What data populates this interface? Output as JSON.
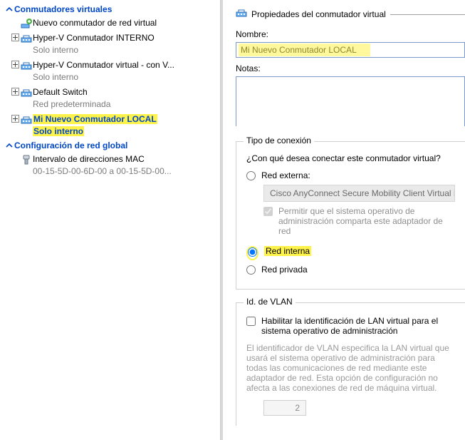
{
  "tree": {
    "section1_label": "Conmutadores virtuales",
    "items": [
      {
        "title": "Nuevo conmutador de red virtual",
        "sub": null,
        "expandable": false,
        "icon": "new-switch"
      },
      {
        "title": "Hyper-V Conmutador INTERNO",
        "sub": "Solo interno",
        "expandable": true,
        "icon": "switch"
      },
      {
        "title": "Hyper-V Conmutador virtual - con V...",
        "sub": "Solo interno",
        "expandable": true,
        "icon": "switch"
      },
      {
        "title": "Default Switch",
        "sub": "Red predeterminada",
        "expandable": true,
        "icon": "switch"
      },
      {
        "title": "Mi Nuevo Conmutador LOCAL",
        "sub": "Solo interno",
        "expandable": true,
        "icon": "switch",
        "selected": true,
        "highlighted": true
      }
    ],
    "section2_label": "Configuración de red global",
    "global_items": [
      {
        "title": "Intervalo de direcciones MAC",
        "sub": "00-15-5D-00-6D-00 a 00-15-5D-00...",
        "icon": "mac"
      }
    ]
  },
  "right": {
    "header_title": "Propiedades del conmutador virtual",
    "name_label": "Nombre:",
    "name_value": "Mi Nuevo Conmutador LOCAL",
    "notes_label": "Notas:",
    "notes_value": "",
    "conn": {
      "group_title": "Tipo de conexión",
      "question": "¿Con qué desea conectar este conmutador virtual?",
      "external_label": "Red externa:",
      "adapter_value": "Cisco AnyConnect Secure Mobility Client Virtual Miniport",
      "allow_mgmt_label": "Permitir que el sistema operativo de administración comparta este adaptador de red",
      "internal_label": "Red interna",
      "private_label": "Red privada",
      "selected": "internal"
    },
    "vlan": {
      "group_title": "Id. de VLAN",
      "enable_label": "Habilitar la identificación de LAN virtual para el sistema operativo de administración",
      "helper": "El identificador de VLAN especifica la LAN virtual que usará el sistema operativo de administración para todas las comunicaciones de red mediante este adaptador de red. Esta opción de configuración no afecta a las conexiones de red de máquina virtual.",
      "value": "2"
    }
  }
}
